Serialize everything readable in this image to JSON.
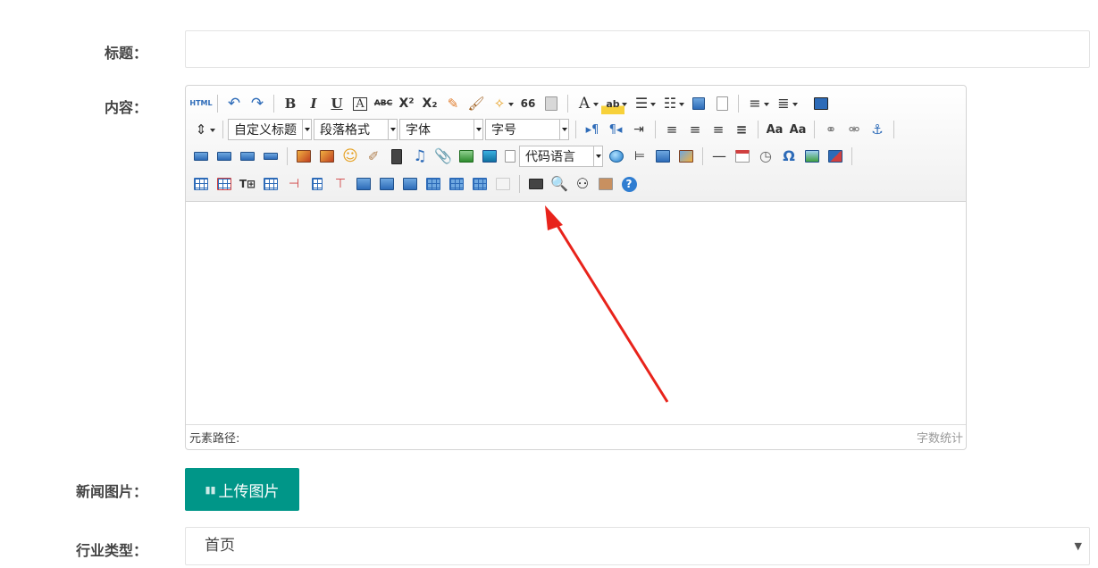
{
  "form": {
    "title_label": "标题：",
    "title_value": "",
    "content_label": "内容：",
    "news_image_label": "新闻图片：",
    "industry_label": "行业类型："
  },
  "editor": {
    "combos": {
      "custom_heading": "自定义标题",
      "paragraph_format": "段落格式",
      "font_family": "字体",
      "font_size": "字号",
      "code_language": "代码语言"
    },
    "glyphs": {
      "html": "HTML",
      "bold": "B",
      "italic": "I",
      "underline": "U",
      "strike": "ABC",
      "superscript": "X²",
      "subscript": "X₂",
      "quote": "66",
      "fontcolor": "A",
      "highlight": "ab",
      "omega": "Ω"
    },
    "icons": [
      "source-icon",
      "undo-icon",
      "redo-icon",
      "bold-icon",
      "italic-icon",
      "underline-icon",
      "fontborder-icon",
      "strikethrough-icon",
      "superscript-icon",
      "subscript-icon",
      "removeformat-icon",
      "formatmatch-icon",
      "autotypeset-icon",
      "blockquote-icon",
      "pasteplain-icon",
      "forecolor-icon",
      "backcolor-icon",
      "insertorderedlist-icon",
      "insertunorderedlist-icon",
      "selectall-icon",
      "cleardoc-icon",
      "rowspacing-icon",
      "lineheight-icon",
      "preview-icon"
    ],
    "status_path": "元素路径:",
    "word_count": "字数统计"
  },
  "upload": {
    "label": "上传图片"
  },
  "industry_select": {
    "value": "首页"
  },
  "colors": {
    "upload_button": "#009688",
    "annotation_arrow": "#e8231b",
    "toolbar_icon_blue": "#2d6bb8"
  }
}
